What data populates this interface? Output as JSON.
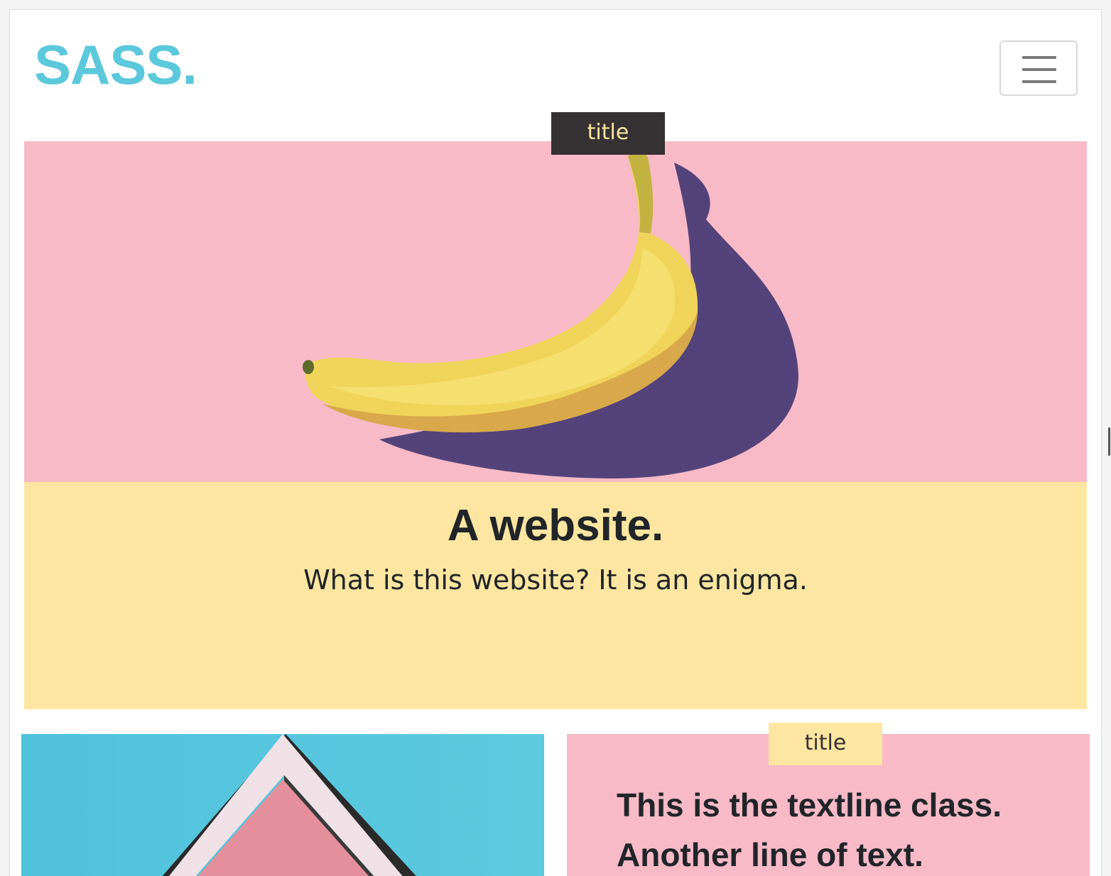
{
  "navbar": {
    "brand": "SASS.",
    "toggle_icon": "hamburger-menu-icon"
  },
  "hero": {
    "tab_label": "title",
    "image_subject": "banana",
    "heading": "A website.",
    "subheading": "What is this website? It is an enigma."
  },
  "cards": {
    "left": {
      "image_subject": "pink-roof-gable"
    },
    "right": {
      "tab_label": "title",
      "lines": [
        "This is the textline class.",
        "Another line of text."
      ]
    }
  },
  "colors": {
    "brand": "#5bc8dc",
    "pink": "#f7bac6",
    "yellow": "#fce6a1",
    "dark": "#363132",
    "text": "#212529",
    "sky": "#5cc8de"
  }
}
